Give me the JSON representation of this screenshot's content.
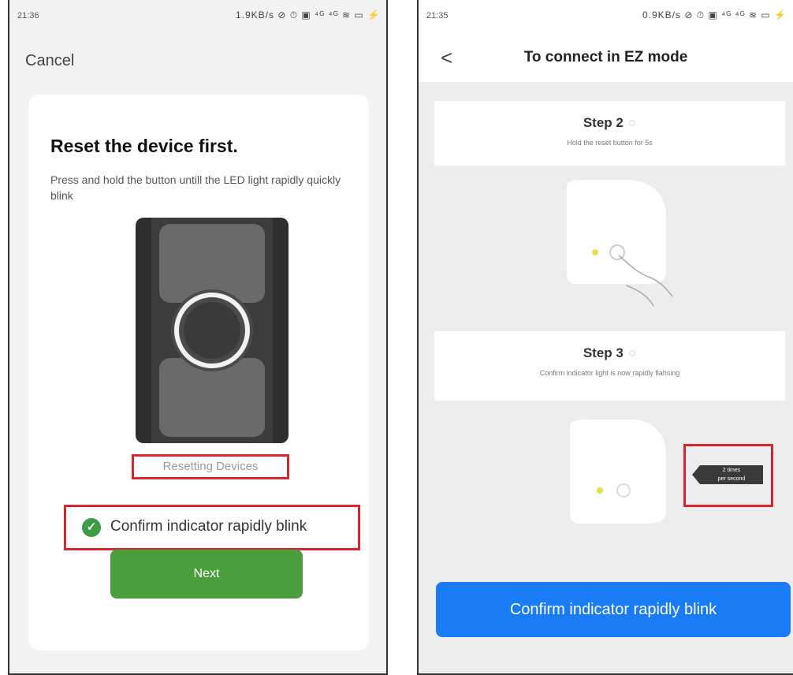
{
  "left": {
    "status": {
      "time": "21:36",
      "icons": "1.9KB/s ⊘ ⏱ ▣ ⁴ᴳ ⁴ᴳ ≋ ▭ ⚡"
    },
    "cancel": "Cancel",
    "title": "Reset the device first.",
    "description": "Press and hold the button untill the LED light rapidly quickly blink",
    "resetting": "Resetting Devices",
    "confirm": "Confirm indicator rapidly blink",
    "next": "Next"
  },
  "right": {
    "status": {
      "time": "21:35",
      "icons": "0.9KB/s ⊘ ⏱ ▣ ⁴ᴳ ⁴ᴳ ≋ ▭ ⚡"
    },
    "title": "To connect in EZ mode",
    "step2": {
      "title": "Step 2",
      "subtitle": "Hold the reset button for 5s"
    },
    "step3": {
      "title": "Step 3",
      "subtitle": "Confirm indicator light is now rapidly flahsing"
    },
    "tag": [
      "2 times",
      "per second"
    ],
    "confirm_button": "Confirm indicator rapidly blink"
  },
  "colors": {
    "green": "#4a9e3c",
    "blue": "#1a7cf5",
    "highlight_red": "#d9262c"
  }
}
